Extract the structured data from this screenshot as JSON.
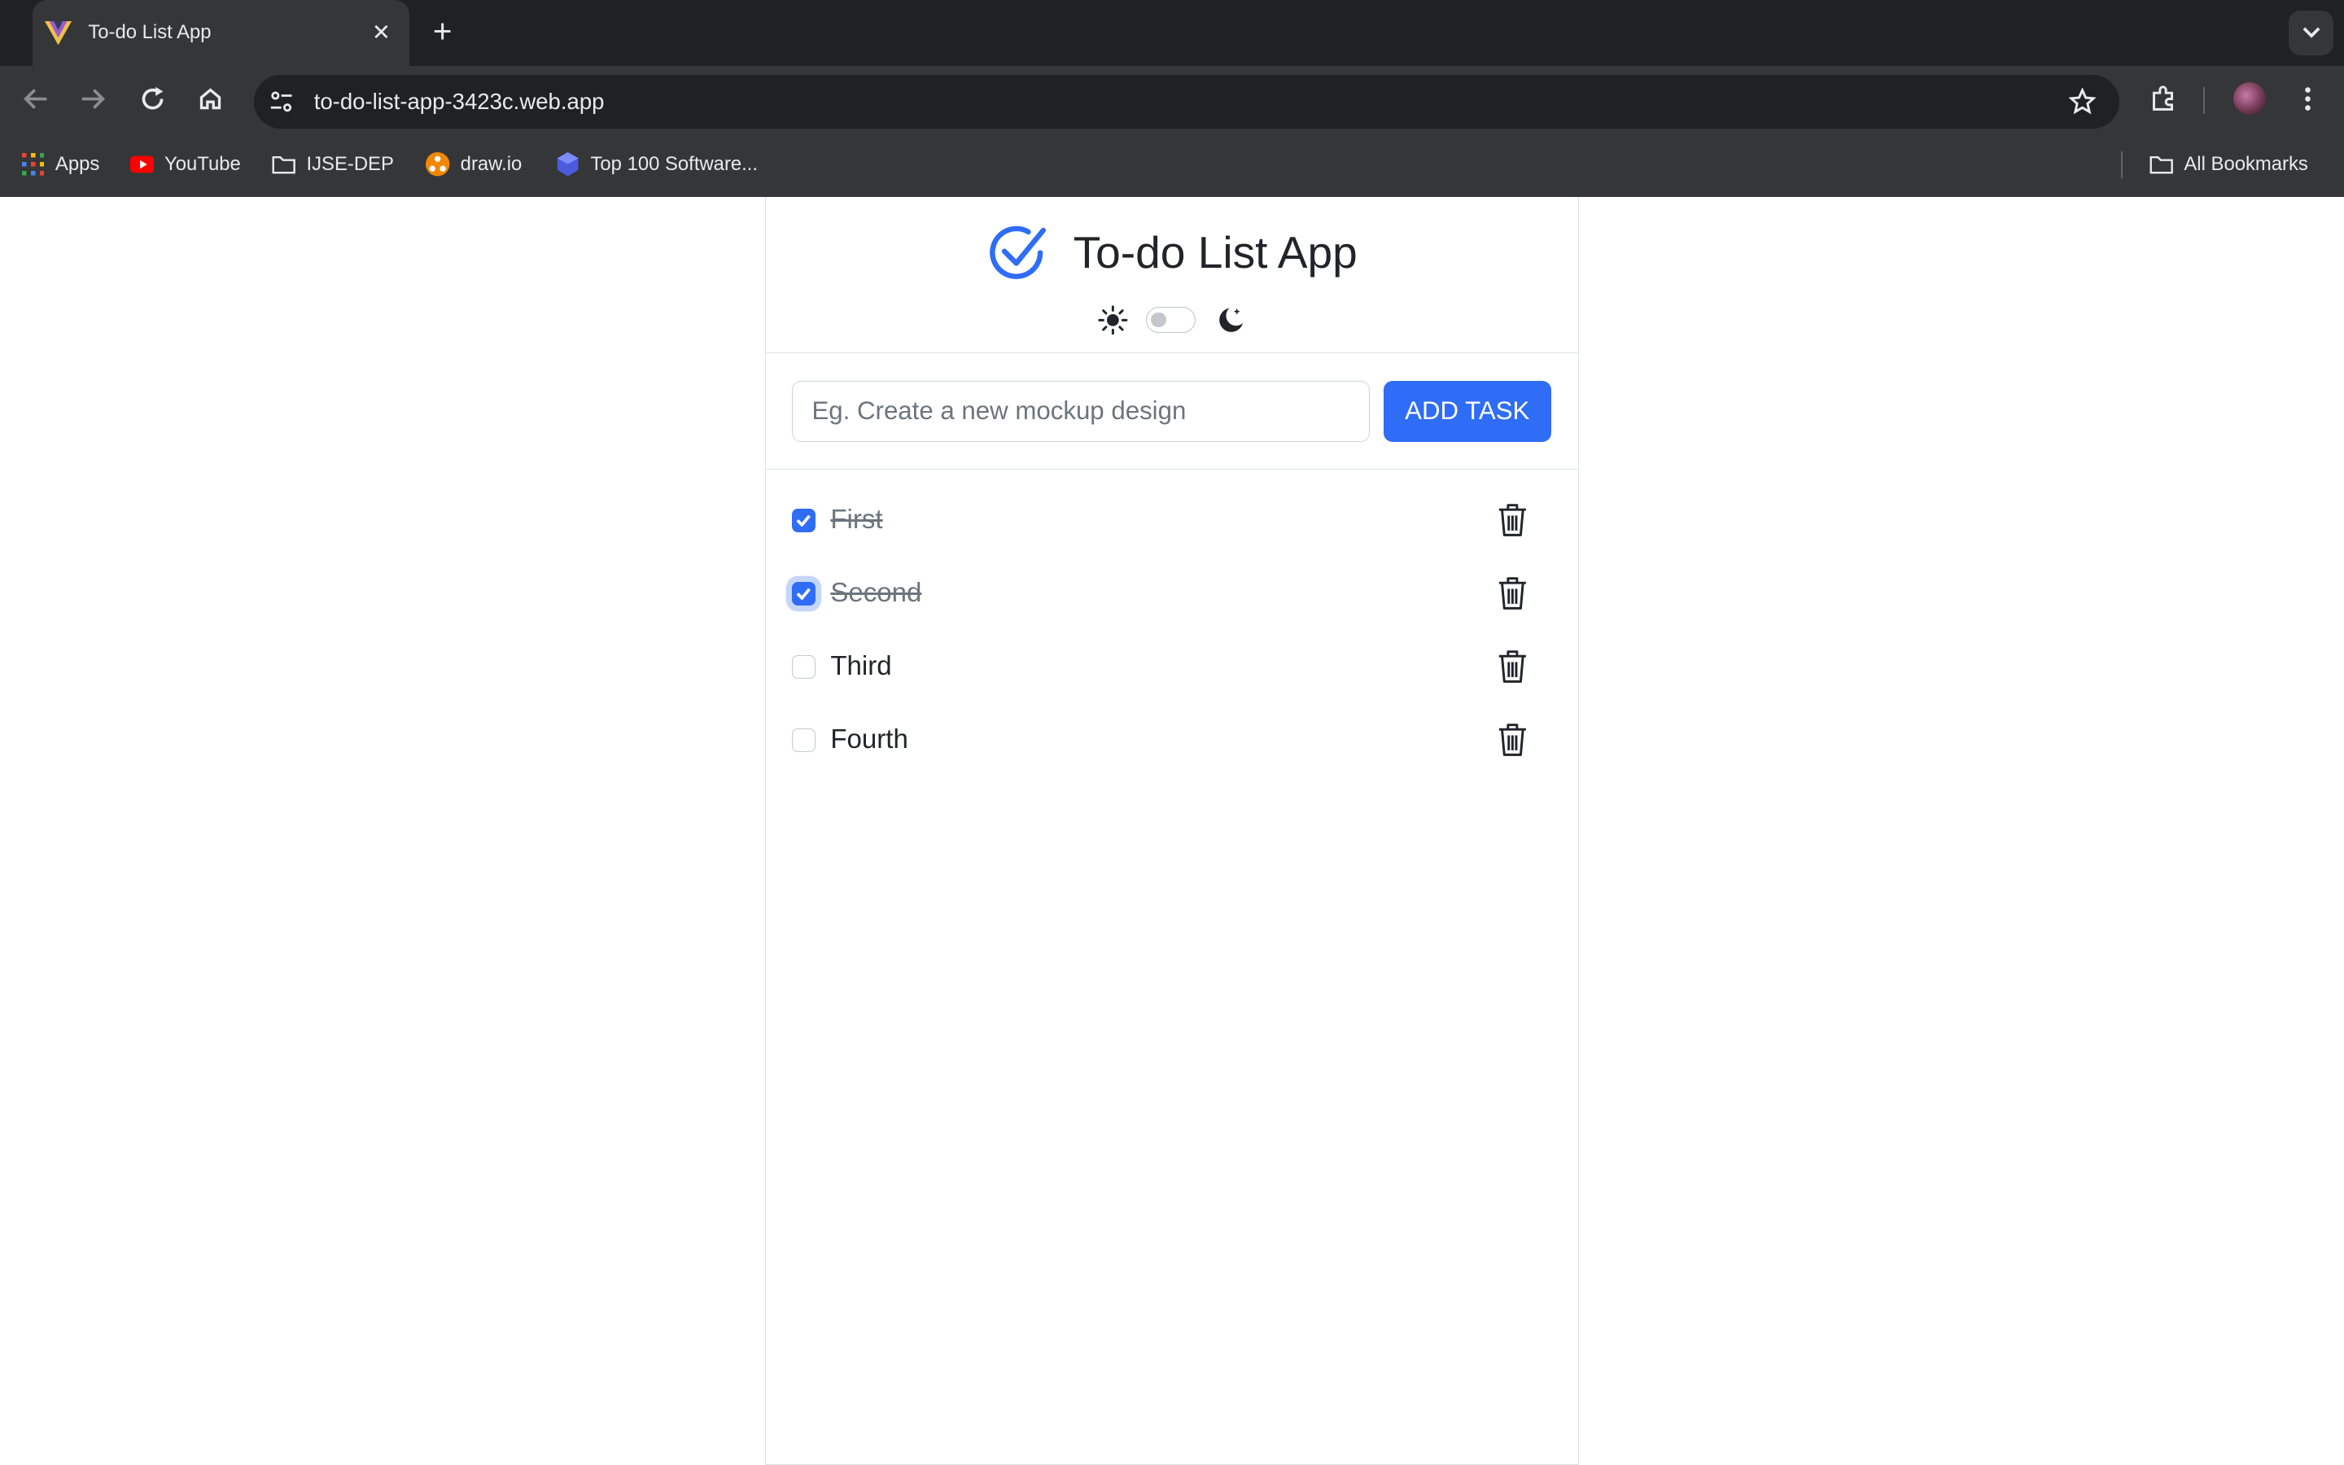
{
  "browser": {
    "tab_title": "To-do List App",
    "url": "to-do-list-app-3423c.web.app",
    "bookmarks": {
      "apps": "Apps",
      "youtube": "YouTube",
      "ijse": "IJSE-DEP",
      "drawio": "draw.io",
      "top100": "Top 100 Software...",
      "all": "All Bookmarks"
    }
  },
  "app": {
    "title": "To-do List App",
    "input_placeholder": "Eg. Create a new mockup design",
    "add_button": "ADD TASK",
    "accent_color": "#2f6df6",
    "dark_mode": false,
    "tasks": [
      {
        "label": "First",
        "done": true
      },
      {
        "label": "Second",
        "done": true
      },
      {
        "label": "Third",
        "done": false
      },
      {
        "label": "Fourth",
        "done": false
      }
    ]
  }
}
